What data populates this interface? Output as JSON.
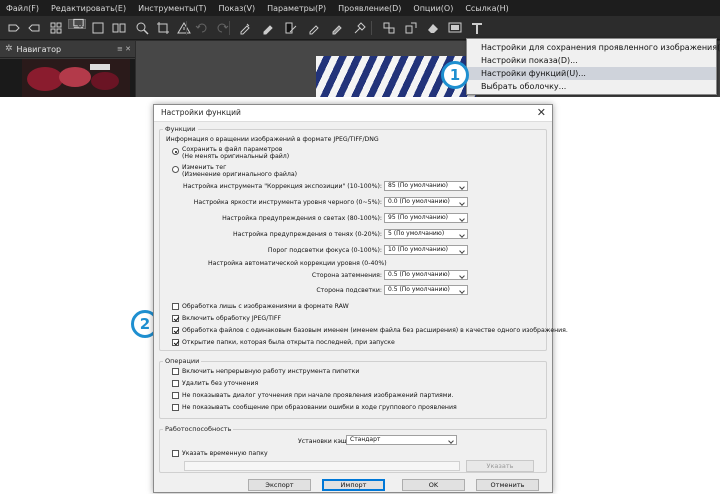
{
  "app": {
    "menu": [
      "Файл(F)",
      "Редактировать(E)",
      "Инструменты(T)",
      "Показ(V)",
      "Параметры(P)",
      "Проявление(D)",
      "Опции(O)",
      "Ссылка(H)"
    ],
    "navigator_title": "Навигатор",
    "dropdown": [
      "Настройки для сохранения проявленного изображения(F)...",
      "Настройки показа(D)...",
      "Настройки функций(U)...",
      "Выбрать оболочку..."
    ],
    "dropdown_highlight_index": 2
  },
  "badges": [
    "1",
    "2"
  ],
  "dialog": {
    "title": "Настройки функций",
    "close_glyph": "✕",
    "functions": {
      "group_label": "Функции",
      "rotation_label": "Информация о вращении изображений в формате JPEG/TIFF/DNG",
      "radio_save_line1": "Сохранить в файл параметров",
      "radio_save_line2": "(Не менять оригинальный файл)",
      "radio_change_line1": "Изменить тег",
      "radio_change_line2": "(Изменение оригинального файла)",
      "settings": [
        {
          "label": "Настройка инструмента \"Коррекция экспозиции\" (10-100%):",
          "value": "85 (По умолчанию)"
        },
        {
          "label": "Настройка яркости инструмента уровня черного (0~5%):",
          "value": "0.0 (По умолчанию)"
        },
        {
          "label": "Настройка предупреждения о светах (80-100%):",
          "value": "95 (По умолчанию)"
        },
        {
          "label": "Настройка предупреждения о тенях (0-20%):",
          "value": "5 (По умолчанию)"
        },
        {
          "label": "Порог подсветки фокуса (0-100%):",
          "value": "10 (По умолчанию)"
        }
      ],
      "auto_level_label": "Настройка автоматической коррекции уровня (0-40%)",
      "auto_level": [
        {
          "label": "Сторона затемнения:",
          "value": "0.5 (По умолчанию)"
        },
        {
          "label": "Сторона подсветки:",
          "value": "0.5 (По умолчанию)"
        }
      ],
      "checkboxes": [
        {
          "label": "Обработка лишь с изображениями в формате RAW",
          "checked": false
        },
        {
          "label": "Включить обработку JPEG/TIFF",
          "checked": true
        },
        {
          "label": "Обработка файлов с одинаковым базовым именем (именем файла без расширения) в качестве одного изображения.",
          "checked": true
        },
        {
          "label": "Открытие папки, которая была открыта последней, при запуске",
          "checked": true
        }
      ]
    },
    "operations": {
      "group_label": "Операции",
      "checkboxes": [
        {
          "label": "Включить непрерывную работу инструмента пипетки",
          "checked": false
        },
        {
          "label": "Удалить без уточнения",
          "checked": false
        },
        {
          "label": "Не показывать диалог уточнения при начале проявления изображений партиями.",
          "checked": false
        },
        {
          "label": "Не показывать сообщение при образовании ошибки в ходе группового проявления",
          "checked": false
        }
      ]
    },
    "performance": {
      "group_label": "Работоспособность",
      "cache_label": "Установки кэша:",
      "cache_value": "Стандарт",
      "temp_folder_label": "Указать временную папку",
      "temp_folder_checked": false,
      "browse_label": "Указать"
    },
    "buttons": {
      "export": "Экспорт",
      "import": "Импорт",
      "ok": "OK",
      "cancel": "Отменить"
    }
  }
}
